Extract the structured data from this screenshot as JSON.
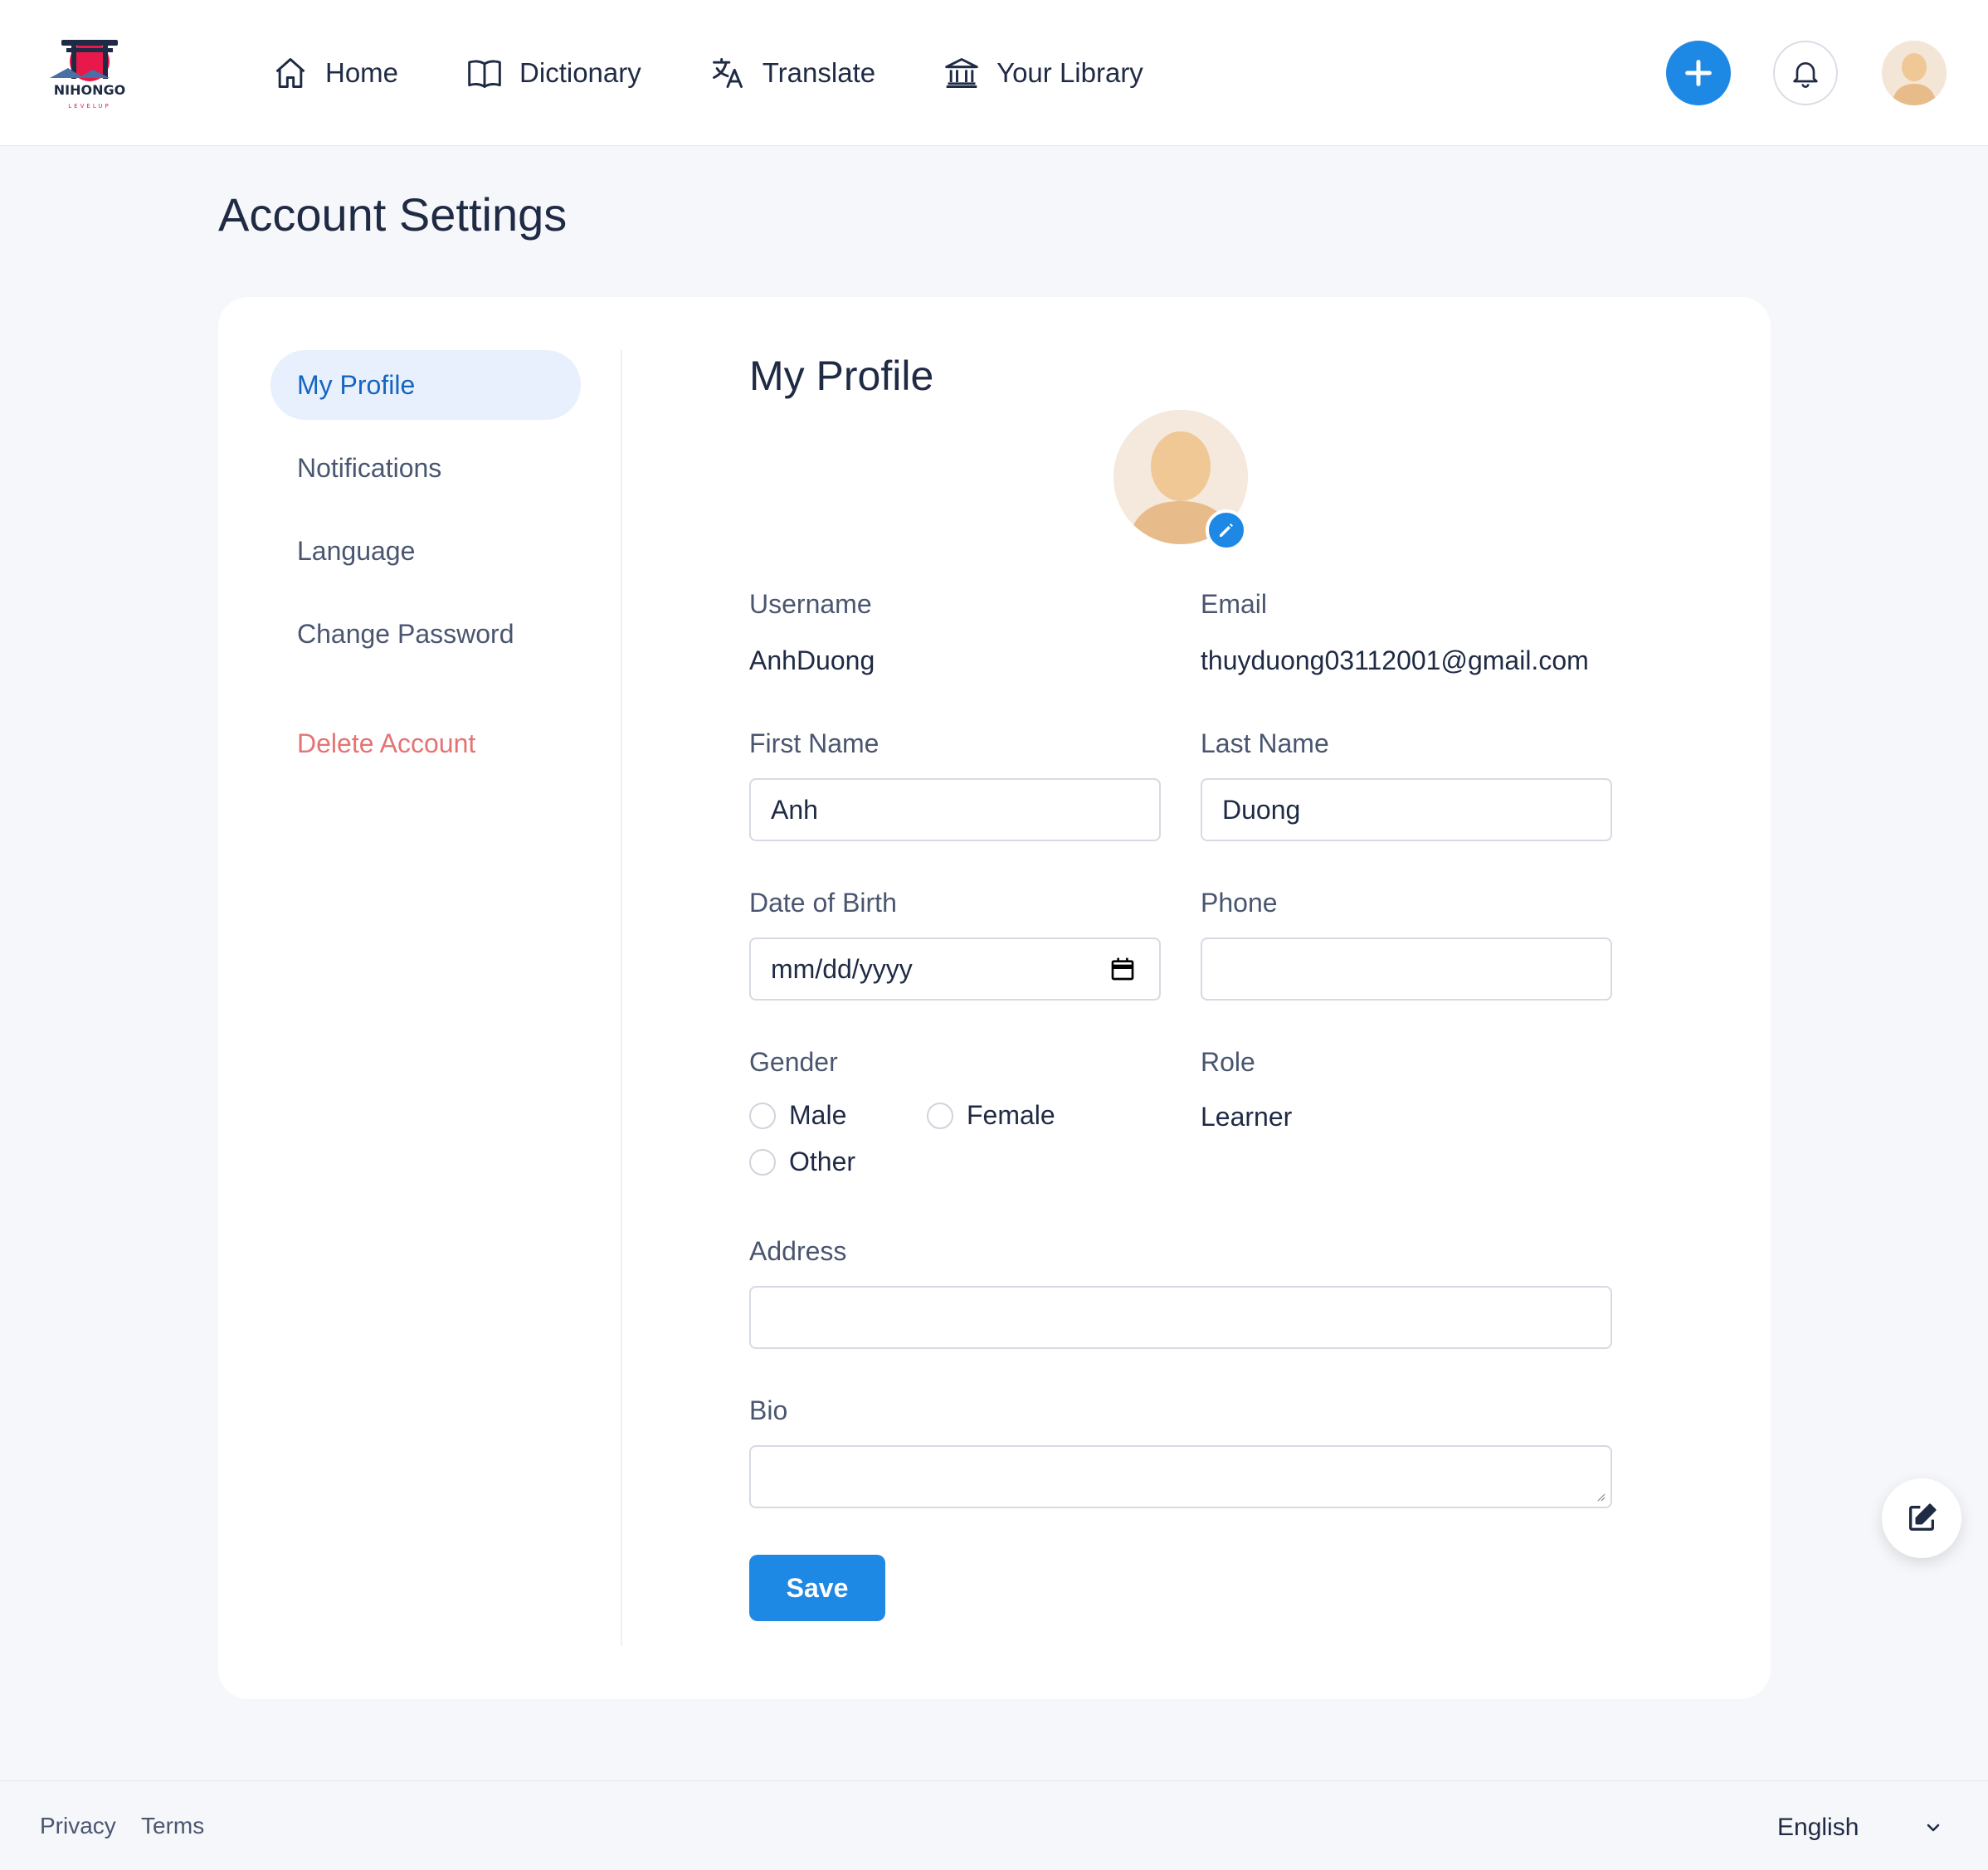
{
  "brand": {
    "name": "NIHONGO",
    "tagline": "LEVELUP",
    "accent": "#e8194a"
  },
  "nav": {
    "items": [
      {
        "label": "Home",
        "icon": "home-icon"
      },
      {
        "label": "Dictionary",
        "icon": "book-icon"
      },
      {
        "label": "Translate",
        "icon": "translate-icon"
      },
      {
        "label": "Your Library",
        "icon": "library-icon"
      }
    ]
  },
  "header_actions": {
    "add_icon": "plus-icon",
    "bell_icon": "bell-icon",
    "avatar_icon": "user-avatar"
  },
  "page": {
    "title": "Account Settings"
  },
  "sidebar": {
    "items": [
      {
        "label": "My Profile",
        "active": true
      },
      {
        "label": "Notifications"
      },
      {
        "label": "Language"
      },
      {
        "label": "Change Password"
      }
    ],
    "danger_item": {
      "label": "Delete Account",
      "color": "#e57373"
    }
  },
  "profile": {
    "title": "My Profile",
    "username": {
      "label": "Username",
      "value": "AnhDuong"
    },
    "email": {
      "label": "Email",
      "value": "thuyduong03112001@gmail.com"
    },
    "first_name": {
      "label": "First Name",
      "value": "Anh"
    },
    "last_name": {
      "label": "Last Name",
      "value": "Duong"
    },
    "dob": {
      "label": "Date of Birth",
      "placeholder": "mm/dd/yyyy"
    },
    "phone": {
      "label": "Phone",
      "value": ""
    },
    "gender": {
      "label": "Gender",
      "options": [
        "Male",
        "Female",
        "Other"
      ],
      "selected": null
    },
    "role": {
      "label": "Role",
      "value": "Learner"
    },
    "address": {
      "label": "Address",
      "value": ""
    },
    "bio": {
      "label": "Bio",
      "value": ""
    },
    "save_label": "Save"
  },
  "footer": {
    "links": [
      "Privacy",
      "Terms"
    ],
    "language": "English"
  },
  "colors": {
    "primary": "#1e88e5",
    "active_bg": "#e8f0fd",
    "active_text": "#1565c0",
    "danger": "#e57373"
  }
}
